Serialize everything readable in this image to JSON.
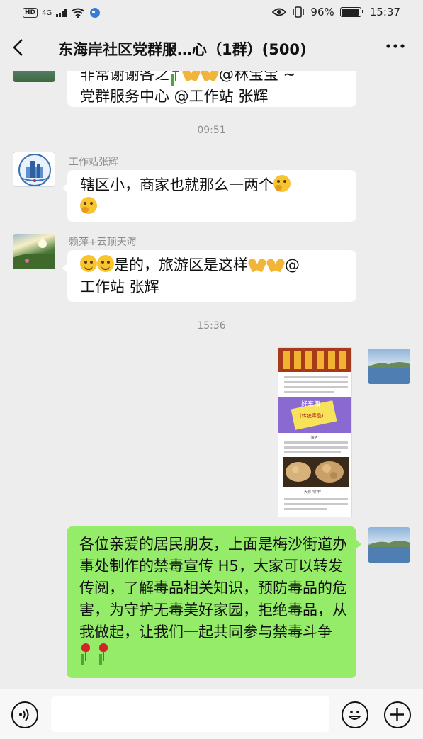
{
  "status_bar": {
    "hd": "HD",
    "signal": "4G",
    "battery": "96%",
    "time": "15:37"
  },
  "header": {
    "back_icon": "chevron-left-icon",
    "title": "东海岸社区党群服…心（1群）(500)",
    "more_icon": "more-icon"
  },
  "messages": [
    {
      "id": "m1",
      "text_line1": "非常谢谢各之",
      "mention": "@林宝宝 ~",
      "text_line2": "党群服务中心 @工作站 张辉"
    },
    {
      "id": "t1",
      "time": "09:51"
    },
    {
      "id": "m2",
      "sender": "工作站张辉",
      "text": "辖区小，商家也就那么一两个"
    },
    {
      "id": "m3",
      "sender": "赖萍+云顶天海",
      "text_a": "是的，旅游区是这样",
      "text_b": "@",
      "text_c": "工作站 张辉"
    },
    {
      "id": "t2",
      "time": "15:36"
    },
    {
      "id": "m4",
      "image_captions": [
        "好东西",
        "(传统毒品)",
        "'海洛'",
        "大麻 '饼干'"
      ]
    },
    {
      "id": "m5",
      "text": "各位亲爱的居民朋友，上面是梅沙街道办事处制作的禁毒宣传 H5，大家可以转发传阅，了解毒品相关知识，预防毒品的危害，为守护无毒美好家园，拒绝毒品，从我做起，让我们一起共同参与禁毒斗争"
    }
  ],
  "input_bar": {
    "voice_icon": "voice-icon",
    "emoji_icon": "emoji-icon",
    "plus_icon": "plus-icon",
    "placeholder": ""
  },
  "colors": {
    "background": "#ededed",
    "bubble_green": "#95ec69",
    "bubble_white": "#ffffff",
    "meta_gray": "#8c8c8c"
  }
}
